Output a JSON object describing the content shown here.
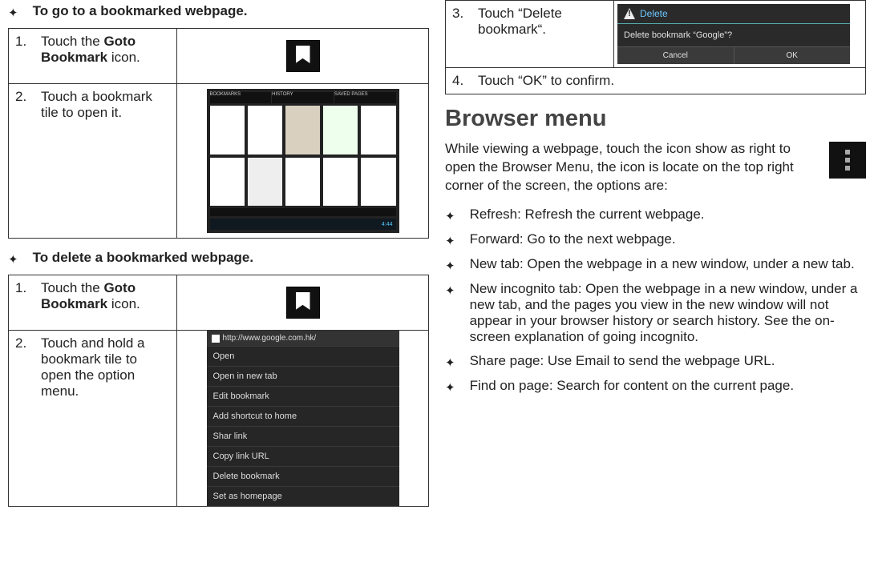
{
  "left": {
    "heading_goto": "To go to a bookmarked webpage.",
    "goto_step1_prefix": "Touch the ",
    "goto_step1_bold": "Goto Bookmark",
    "goto_step1_suffix": " icon.",
    "goto_step2": "Touch a bookmark tile to open it.",
    "heading_delete": "To delete a bookmarked webpage.",
    "del_step1_prefix": "Touch the ",
    "del_step1_bold": "Goto Bookmark",
    "del_step1_suffix": " icon.",
    "del_step2": "Touch and hold a bookmark tile to open the option menu.",
    "menu_url": "http://www.google.com.hk/",
    "menu_items": [
      "Open",
      "Open in new tab",
      "Edit bookmark",
      "Add shortcut to home",
      "Shar link",
      "Copy link URL",
      "Delete bookmark",
      "Set as homepage"
    ],
    "tiles_tabs": [
      "BOOKMARKS",
      "HISTORY",
      "SAVED PAGES"
    ],
    "tiles_time": "4:44"
  },
  "right": {
    "step3": "Touch “Delete bookmark“.",
    "step4": "Touch “OK” to confirm.",
    "dialog_title": "Delete",
    "dialog_msg": "Delete bookmark “Google”?",
    "dialog_cancel": "Cancel",
    "dialog_ok": "OK",
    "heading": "Browser menu",
    "intro": "While viewing a webpage, touch the icon show as right to open the Browser Menu, the icon is locate on the top right corner of the screen, the options are:",
    "items": [
      "Refresh: Refresh the current webpage.",
      "Forward: Go to the next webpage.",
      "New tab: Open the webpage in a new window, under a new tab.",
      "New incognito tab: Open the webpage in a new win­dow, under a new tab, and the pages you view in the new window will not appear in your browser history or search history. See the on-screen explanation of going incognito.",
      "Share page: Use Email to send the webpage URL.",
      "Find on page: Search for content on the current page."
    ]
  },
  "nums": {
    "n1": "1.",
    "n2": "2.",
    "n3": "3.",
    "n4": "4."
  }
}
